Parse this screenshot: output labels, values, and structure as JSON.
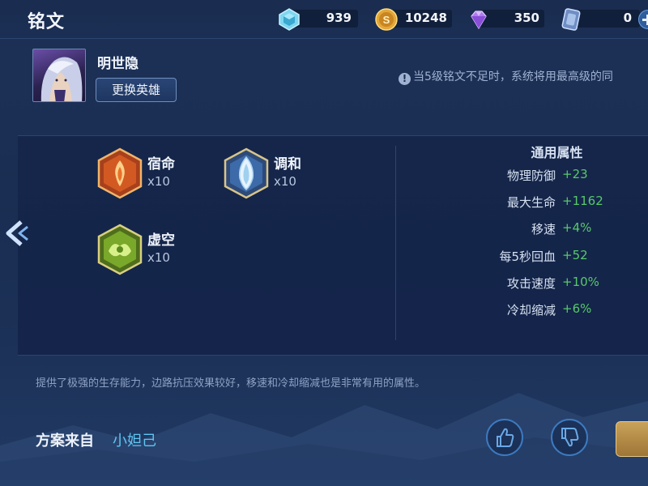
{
  "header": {
    "title": "铭文",
    "currencies": [
      {
        "icon": "diamond-crystal-icon",
        "value": "939"
      },
      {
        "icon": "gold-coin-icon",
        "value": "10248"
      },
      {
        "icon": "purple-gem-icon",
        "value": "350"
      },
      {
        "icon": "card-coupon-icon",
        "value": "0"
      }
    ],
    "add_icon": "plus-icon"
  },
  "hero": {
    "name": "明世隐",
    "change_button": "更换英雄"
  },
  "notice": {
    "icon": "info-icon",
    "icon_glyph": "!",
    "text": "当5级铭文不足时，系统将用最高级的同"
  },
  "runes": [
    {
      "name": "宿命",
      "count": "x10",
      "color": "red"
    },
    {
      "name": "调和",
      "count": "x10",
      "color": "blue"
    },
    {
      "name": "虚空",
      "count": "x10",
      "color": "green"
    }
  ],
  "attributes": {
    "title": "通用属性",
    "rows": [
      {
        "name": "物理防御",
        "value": "+23"
      },
      {
        "name": "最大生命",
        "value": "+1162"
      },
      {
        "name": "移速",
        "value": "+4%"
      },
      {
        "name": "每5秒回血",
        "value": "+52"
      },
      {
        "name": "攻击速度",
        "value": "+10%"
      },
      {
        "name": "冷却缩减",
        "value": "+6%"
      }
    ]
  },
  "description": "提供了极强的生存能力，边路抗压效果较好，移速和冷却缩减也是非常有用的属性。",
  "source": {
    "label": "方案来自",
    "author": "小妲己"
  },
  "colors": {
    "accent_green": "#58c86a",
    "link_blue": "#5fc6f2",
    "panel_bg": "#15264a"
  }
}
